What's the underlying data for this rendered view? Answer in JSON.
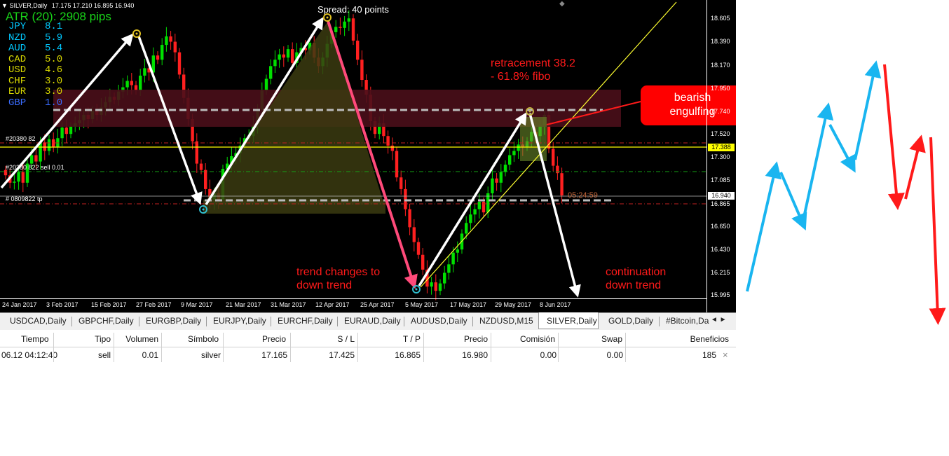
{
  "chart": {
    "header_symbol": "SILVER,Daily",
    "header_ohlc": "17.175 17.210 16.895 16.940",
    "atr": "ATR (20): 2908 pips",
    "strength": [
      {
        "ccy": "JPY",
        "val": "8.1",
        "color": "#00c8ff"
      },
      {
        "ccy": "NZD",
        "val": "5.9",
        "color": "#00c8ff"
      },
      {
        "ccy": "AUD",
        "val": "5.4",
        "color": "#00c8ff"
      },
      {
        "ccy": "CAD",
        "val": "5.0",
        "color": "#d8d800"
      },
      {
        "ccy": "USD",
        "val": "4.6",
        "color": "#d8d800"
      },
      {
        "ccy": "CHF",
        "val": "3.0",
        "color": "#d8d800"
      },
      {
        "ccy": "EUR",
        "val": "3.0",
        "color": "#d8d800"
      },
      {
        "ccy": "GBP",
        "val": "1.0",
        "color": "#3a6cff"
      }
    ],
    "spread": "Spread: 40 points",
    "order_labels": [
      "#20380 82",
      "#20380 822 sell 0.01",
      "# 0809822 tp"
    ],
    "annotations": {
      "retracement": "retracement 38.2\n- 61.8% fibo",
      "bearish": "bearish\nengulfing",
      "trend_change": "trend changes to\ndown trend",
      "continuation": "continuation\ndown trend"
    },
    "countdown": "05:24:59",
    "price_axis": [
      "18.605",
      "18.390",
      "18.170",
      "17.950",
      "17.740",
      "17.520",
      "17.300",
      "17.085",
      "16.865",
      "16.650",
      "16.430",
      "16.215",
      "15.995"
    ],
    "price_tags": {
      "yellow": "17.388",
      "current": "16.940"
    },
    "date_axis": [
      "24 Jan 2017",
      "3 Feb 2017",
      "15 Feb 2017",
      "27 Feb 2017",
      "9 Mar 2017",
      "21 Mar 2017",
      "31 Mar 2017",
      "12 Apr 2017",
      "25 Apr 2017",
      "5 May 2017",
      "17 May 2017",
      "29 May 2017",
      "8 Jun 2017"
    ],
    "colors": {
      "bull": "#00e000",
      "bear": "#ff2020",
      "bg": "#000000",
      "grid_text": "#ffffff"
    },
    "close_path": [
      17.13,
      17.06,
      17.07,
      17.16,
      17.06,
      17.24,
      17.32,
      17.26,
      17.44,
      17.36,
      17.47,
      17.4,
      17.48,
      17.58,
      17.52,
      17.59,
      17.62,
      17.65,
      17.7,
      17.66,
      17.74,
      17.7,
      17.77,
      17.82,
      17.87,
      17.84,
      17.92,
      17.96,
      18.02,
      17.98,
      17.93,
      18.07,
      18.14,
      18.1,
      18.26,
      18.22,
      18.36,
      18.44,
      18.39,
      18.29,
      18.08,
      17.86,
      17.66,
      17.45,
      17.24,
      17.18,
      17.0,
      16.88,
      16.96,
      16.9,
      17.19,
      17.24,
      17.31,
      17.34,
      17.41,
      17.48,
      17.5,
      17.6,
      17.75,
      17.93,
      18.04,
      18.16,
      18.22,
      18.27,
      18.24,
      18.32,
      18.19,
      18.29,
      18.33,
      18.31,
      18.38,
      18.24,
      18.16,
      18.24,
      18.37,
      18.48,
      18.53,
      18.52,
      18.58,
      18.61,
      18.4,
      18.22,
      18.03,
      17.89,
      17.64,
      17.52,
      17.62,
      17.5,
      17.41,
      17.36,
      17.11,
      17.0,
      16.81,
      16.64,
      16.5,
      16.38,
      16.24,
      16.08,
      16.12,
      16.04,
      16.11,
      16.21,
      16.29,
      16.4,
      16.43,
      16.58,
      16.68,
      16.76,
      16.81,
      16.88,
      16.78,
      16.96,
      17.1,
      17.06,
      17.16,
      17.23,
      17.32,
      17.36,
      17.42,
      17.4,
      17.45,
      17.54,
      17.5,
      17.6,
      17.7,
      17.38,
      17.22,
      17.15,
      16.94
    ]
  },
  "tabs": [
    {
      "label": "USDCAD,Daily"
    },
    {
      "label": "GBPCHF,Daily"
    },
    {
      "label": "EURGBP,Daily"
    },
    {
      "label": "EURJPY,Daily"
    },
    {
      "label": "EURCHF,Daily"
    },
    {
      "label": "EURAUD,Daily"
    },
    {
      "label": "AUDUSD,Daily"
    },
    {
      "label": "NZDUSD,M15"
    },
    {
      "label": "SILVER,Daily"
    },
    {
      "label": "GOLD,Daily"
    },
    {
      "label": "#Bitcoin,Da"
    }
  ],
  "tab_scroll": "◄ ►",
  "terminal": {
    "headers": [
      "Tiempo",
      "Tipo",
      "Volumen",
      "Símbolo",
      "Precio",
      "S / L",
      "T / P",
      "Precio",
      "Comisión",
      "Swap",
      "Beneficios"
    ],
    "row": [
      "06.12 04:12:40",
      "sell",
      "0.01",
      "silver",
      "17.165",
      "17.425",
      "16.865",
      "16.980",
      "0.00",
      "0.00",
      "185"
    ],
    "close_glyph": "×"
  }
}
